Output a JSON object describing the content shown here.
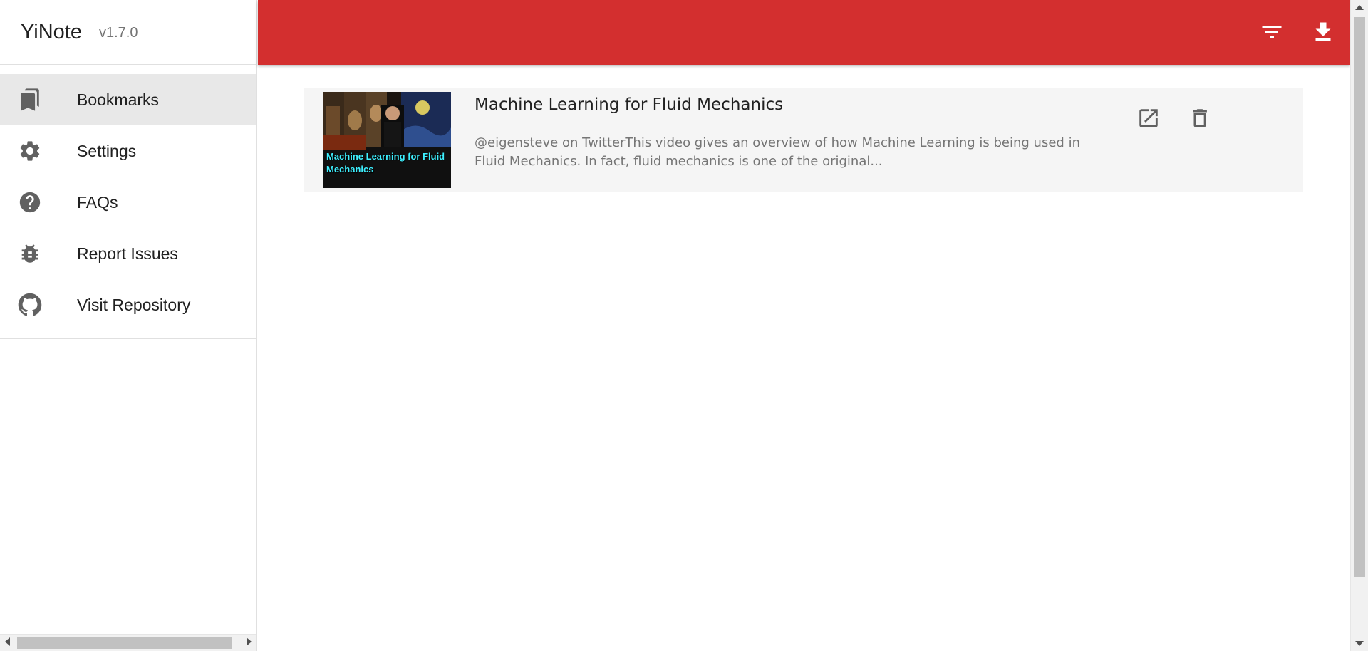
{
  "app": {
    "name": "YiNote",
    "version": "v1.7.0"
  },
  "sidebar": {
    "items": [
      {
        "label": "Bookmarks",
        "icon": "bookmarks-icon",
        "active": true
      },
      {
        "label": "Settings",
        "icon": "gear-icon",
        "active": false
      },
      {
        "label": "FAQs",
        "icon": "help-icon",
        "active": false
      },
      {
        "label": "Report Issues",
        "icon": "bug-icon",
        "active": false
      },
      {
        "label": "Visit Repository",
        "icon": "github-icon",
        "active": false
      }
    ]
  },
  "toolbar": {
    "filter_icon": "filter-icon",
    "download_icon": "download-icon"
  },
  "bookmarks": [
    {
      "title": "Machine Learning for Fluid Mechanics",
      "thumbnail_text": "Machine Learning for Fluid Mechanics",
      "description": "@eigensteve on TwitterThis video gives an overview of how Machine Learning is being used in Fluid Mechanics. In fact, fluid mechanics is one of the original...",
      "actions": [
        "open-in-new-icon",
        "delete-icon"
      ]
    }
  ],
  "colors": {
    "accent": "#d32f2f",
    "active_item_bg": "#e8e8e8",
    "card_bg": "#f5f5f5"
  }
}
